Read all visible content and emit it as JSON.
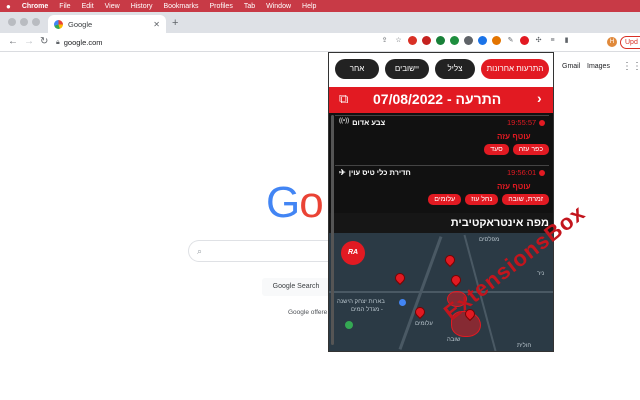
{
  "menubar": {
    "app": "Chrome",
    "items": [
      "File",
      "Edit",
      "View",
      "History",
      "Bookmarks",
      "Profiles",
      "Tab",
      "Window",
      "Help"
    ]
  },
  "tab": {
    "title": "Google"
  },
  "toolbar": {
    "url": "google.com",
    "profile_initial": "H",
    "update_label": "Upd"
  },
  "google": {
    "gmail": "Gmail",
    "images": "Images",
    "logo": "Google",
    "search_button": "Google Search",
    "offered_in": "Google offere"
  },
  "popup": {
    "tabs": {
      "recent": "התרעות אחרונות",
      "tzeil": "צליל",
      "settlements": "יישובים",
      "other": "אחר"
    },
    "header_title": "התרעה - 07/08/2022",
    "alerts": [
      {
        "time": "19:55:57",
        "kind": "צבע אדום",
        "kind_icon": "((•))",
        "region": "עוטף עזה",
        "places": [
          "כפר עזה",
          "סעד"
        ]
      },
      {
        "time": "19:56:01",
        "kind": "חדירת כלי טיס עוין",
        "kind_icon": "✈",
        "region": "עוטף עזה",
        "places": [
          "זמרת, שובה",
          "נחל עוז",
          "עלומים"
        ]
      }
    ],
    "map_title": "מפה אינטראקטיבית",
    "map_labels": [
      "מפלסים",
      "ניר",
      "בארות יצחק הישנה",
      "- מגדל המים",
      "עלומים",
      "שובה",
      "חולית"
    ],
    "logo_text": "RA"
  },
  "watermark": "ExtensionsBox"
}
